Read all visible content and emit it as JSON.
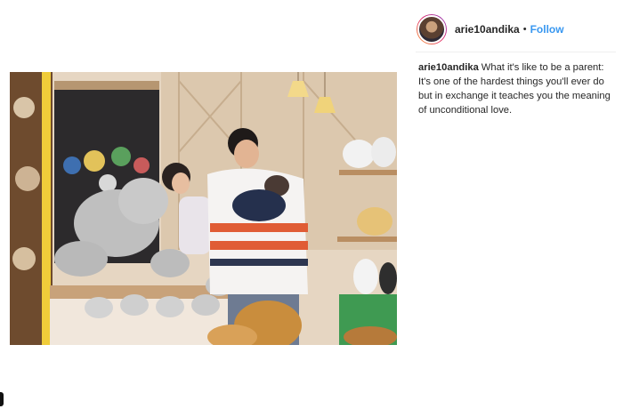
{
  "post": {
    "author": {
      "username": "arie10andika",
      "separator": "•",
      "follow_label": "Follow",
      "avatar_icon": "profile-avatar"
    },
    "caption": {
      "username": "arie10andika",
      "text": "What it's like to be a parent: It's one of the hardest things you'll ever do but in exchange it teaches you the meaning of unconditional love."
    },
    "photo": {
      "subject": "family-holding-baby-in-plush-toy-store"
    }
  },
  "colors": {
    "follow": "#3897f0",
    "text": "#262626",
    "divider": "#efefef"
  }
}
